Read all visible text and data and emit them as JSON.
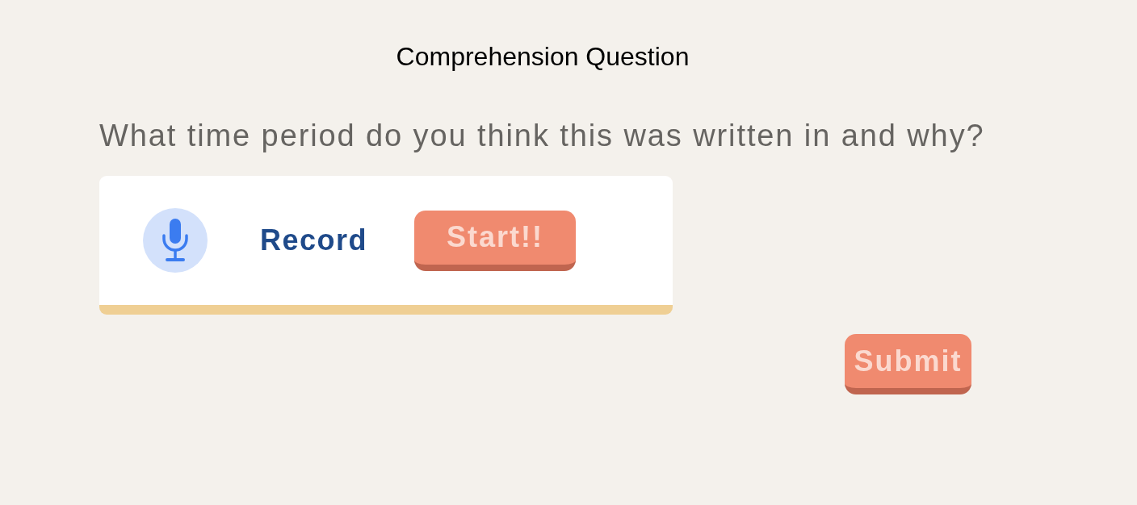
{
  "header": {
    "title": "Comprehension Question"
  },
  "question": {
    "text": "What time period do you think this was written in and why?"
  },
  "recorder": {
    "label": "Record",
    "start_button": "Start!!"
  },
  "submit_button": "Submit"
}
